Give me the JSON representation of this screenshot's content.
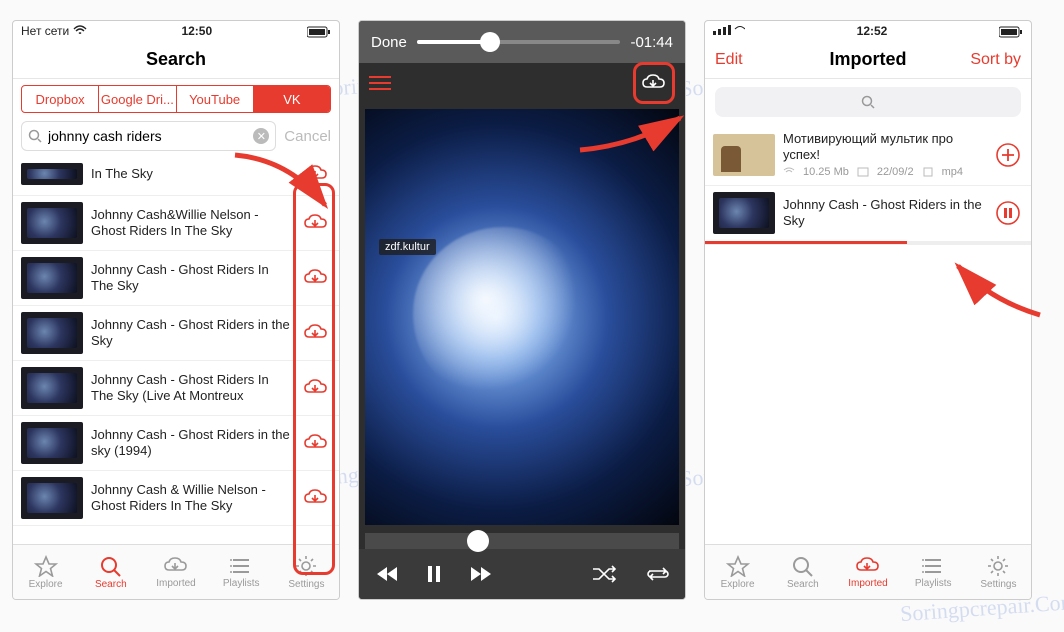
{
  "watermark_text": "Soringpcrepair.Com",
  "accent": "#e63b2e",
  "phone1": {
    "status": {
      "carrier": "Нет сети",
      "time": "12:50"
    },
    "header": {
      "title": "Search"
    },
    "sources": [
      {
        "label": "Dropbox",
        "active": false
      },
      {
        "label": "Google Dri...",
        "active": false
      },
      {
        "label": "YouTube",
        "active": false
      },
      {
        "label": "VK",
        "active": true
      }
    ],
    "search": {
      "value": "johnny cash riders",
      "cancel": "Cancel"
    },
    "results": [
      {
        "title": "In The Sky"
      },
      {
        "title": "Johnny Cash&Willie Nelson - Ghost Riders In The Sky"
      },
      {
        "title": "Johnny Cash - Ghost Riders In The Sky"
      },
      {
        "title": "Johnny Cash - Ghost Riders in the Sky"
      },
      {
        "title": "Johnny Cash - Ghost Riders In The Sky (Live At Montreux"
      },
      {
        "title": "Johnny Cash - Ghost Riders in the sky (1994)"
      },
      {
        "title": "Johnny Cash & Willie Nelson - Ghost Riders In The Sky"
      }
    ],
    "tabs": [
      {
        "label": "Explore",
        "icon": "star",
        "active": false
      },
      {
        "label": "Search",
        "icon": "search",
        "active": true
      },
      {
        "label": "Imported",
        "icon": "cloud",
        "active": false
      },
      {
        "label": "Playlists",
        "icon": "list",
        "active": false
      },
      {
        "label": "Settings",
        "icon": "gear",
        "active": false
      }
    ]
  },
  "phone2": {
    "done": "Done",
    "time_remaining": "-01:44",
    "channel_tag": "zdf.kultur"
  },
  "phone3": {
    "status": {
      "time": "12:52"
    },
    "header": {
      "left": "Edit",
      "title": "Imported",
      "right": "Sort by"
    },
    "items": [
      {
        "title": "Мотивирующий мультик про успех!",
        "size": "10.25 Mb",
        "date": "22/09/2",
        "fmt": "mp4",
        "action": "add"
      },
      {
        "title": "Johnny Cash - Ghost Riders in the Sky",
        "action": "pause",
        "progress": 0.62
      }
    ],
    "tabs": [
      {
        "label": "Explore",
        "icon": "star",
        "active": false
      },
      {
        "label": "Search",
        "icon": "search",
        "active": false
      },
      {
        "label": "Imported",
        "icon": "cloud",
        "active": true
      },
      {
        "label": "Playlists",
        "icon": "list",
        "active": false
      },
      {
        "label": "Settings",
        "icon": "gear",
        "active": false
      }
    ]
  }
}
